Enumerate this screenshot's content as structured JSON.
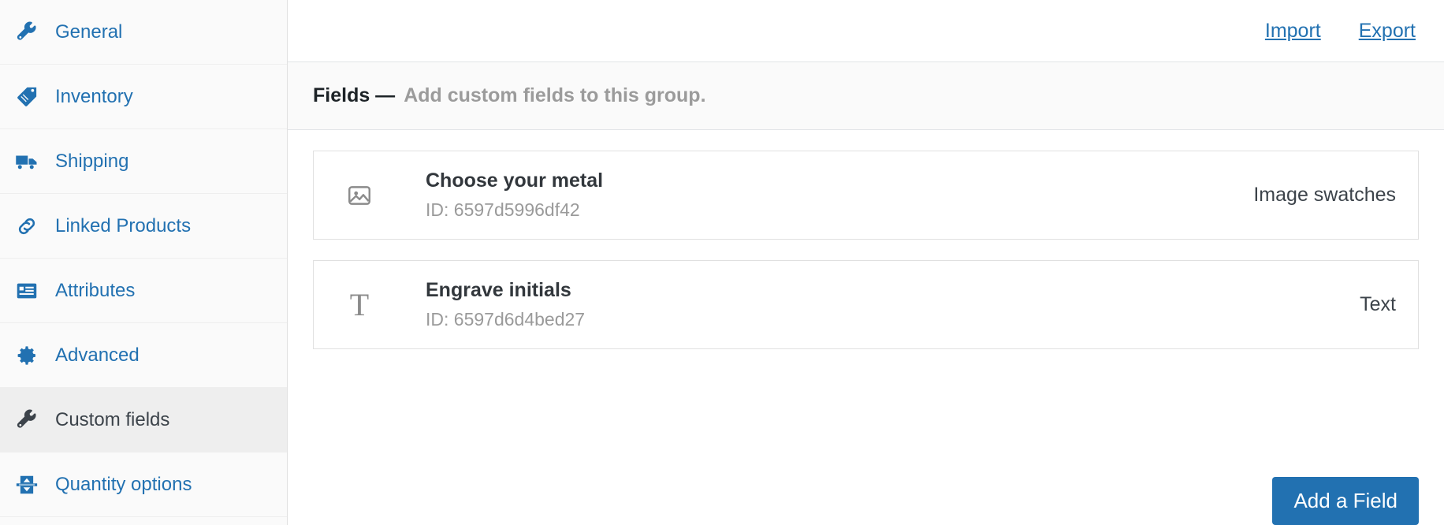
{
  "sidebar": {
    "items": [
      {
        "label": "General",
        "icon": "wrench-icon",
        "active": false
      },
      {
        "label": "Inventory",
        "icon": "tag-icon",
        "active": false
      },
      {
        "label": "Shipping",
        "icon": "truck-icon",
        "active": false
      },
      {
        "label": "Linked Products",
        "icon": "link-icon",
        "active": false
      },
      {
        "label": "Attributes",
        "icon": "list-table-icon",
        "active": false
      },
      {
        "label": "Advanced",
        "icon": "gear-icon",
        "active": false
      },
      {
        "label": "Custom fields",
        "icon": "wrench-icon",
        "active": true
      },
      {
        "label": "Quantity options",
        "icon": "stepper-icon",
        "active": false
      }
    ]
  },
  "topbar": {
    "import_label": "Import",
    "export_label": "Export"
  },
  "section": {
    "title": "Fields —",
    "subtitle": "Add custom fields to this group."
  },
  "fields": [
    {
      "icon": "image-icon",
      "title": "Choose your metal",
      "id_label": "ID: 6597d5996df42",
      "type": "Image swatches"
    },
    {
      "icon": "text-icon",
      "title": "Engrave initials",
      "id_label": "ID: 6597d6d4bed27",
      "type": "Text"
    }
  ],
  "footer": {
    "add_field_label": "Add a Field"
  },
  "colors": {
    "link": "#2271b1",
    "accent": "#2271b1",
    "muted": "#9a9a9a",
    "sidebar_bg": "#fafafa",
    "active_bg": "#eeeeee"
  }
}
